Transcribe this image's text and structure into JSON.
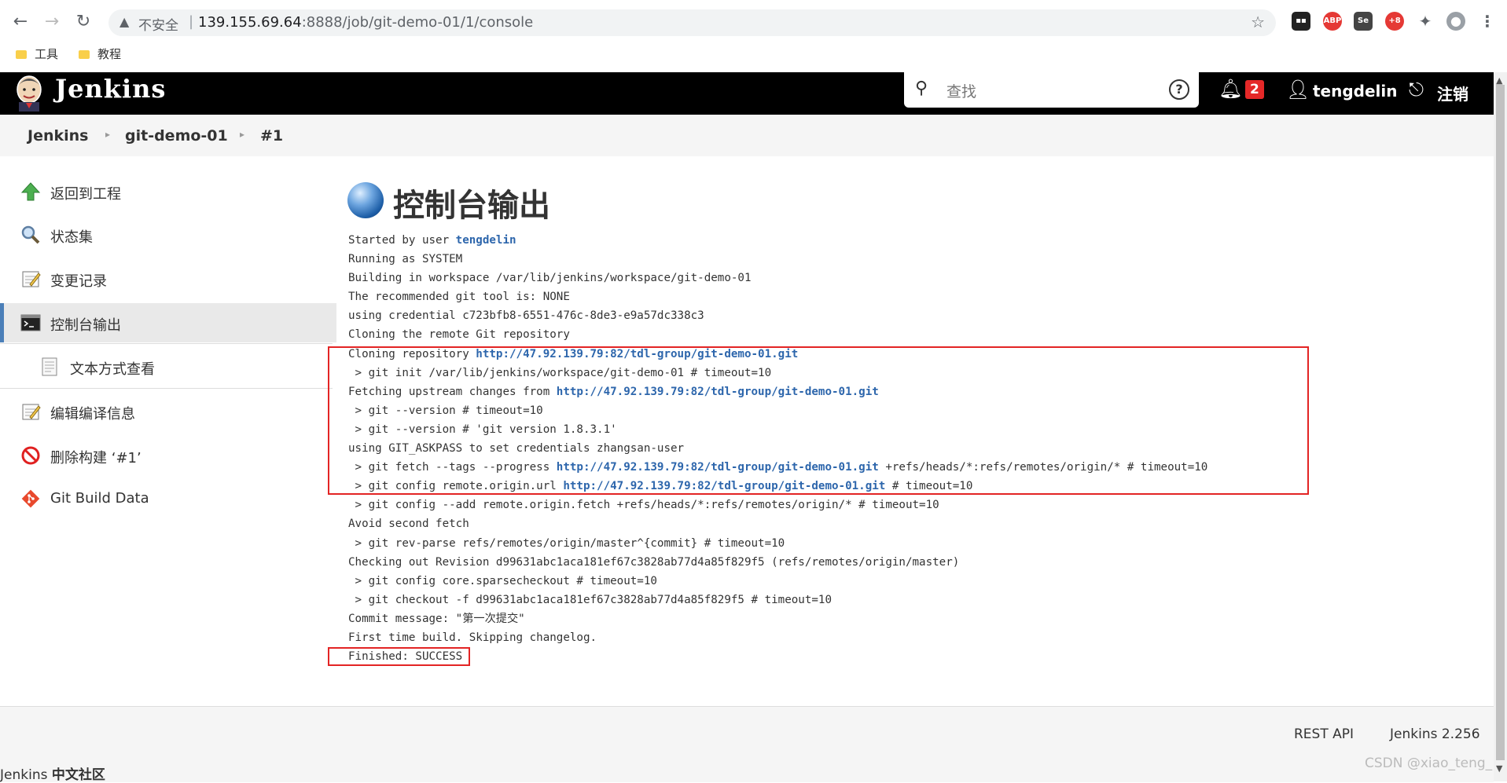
{
  "browser": {
    "insecure_label": "不安全",
    "url_host": "139.155.69.64",
    "url_path": ":8888/job/git-demo-01/1/console",
    "bookmarks": [
      "工具",
      "教程"
    ]
  },
  "header": {
    "title": "Jenkins",
    "search_placeholder": "查找",
    "notification_count": "2",
    "username": "tengdelin",
    "logout": "注销"
  },
  "breadcrumb": [
    "Jenkins",
    "git-demo-01",
    "#1"
  ],
  "sidebar": {
    "items": [
      {
        "label": "返回到工程",
        "icon": "up-arrow-icon"
      },
      {
        "label": "状态集",
        "icon": "magnifier-icon"
      },
      {
        "label": "变更记录",
        "icon": "notepad-icon"
      },
      {
        "label": "控制台输出",
        "icon": "terminal-icon"
      },
      {
        "label": "文本方式查看",
        "icon": "document-icon"
      },
      {
        "label": "编辑编译信息",
        "icon": "notepad-edit-icon"
      },
      {
        "label": "删除构建 ‘#1’",
        "icon": "no-entry-icon"
      },
      {
        "label": "Git Build Data",
        "icon": "git-icon"
      }
    ]
  },
  "main": {
    "title": "控制台输出",
    "console": [
      {
        "t": "Started by user ",
        "link": "tengdelin",
        "r": ""
      },
      {
        "t": "Running as SYSTEM"
      },
      {
        "t": "Building in workspace /var/lib/jenkins/workspace/git-demo-01"
      },
      {
        "t": "The recommended git tool is: NONE"
      },
      {
        "t": "using credential c723bfb8-6551-476c-8de3-e9a57dc338c3"
      },
      {
        "t": "Cloning the remote Git repository"
      },
      {
        "t": "Cloning repository ",
        "link": "http://47.92.139.79:82/tdl-group/git-demo-01.git",
        "r": ""
      },
      {
        "t": " > git init /var/lib/jenkins/workspace/git-demo-01 # timeout=10"
      },
      {
        "t": "Fetching upstream changes from ",
        "link": "http://47.92.139.79:82/tdl-group/git-demo-01.git",
        "r": ""
      },
      {
        "t": " > git --version # timeout=10"
      },
      {
        "t": " > git --version # 'git version 1.8.3.1'"
      },
      {
        "t": "using GIT_ASKPASS to set credentials zhangsan-user"
      },
      {
        "t": " > git fetch --tags --progress ",
        "link": "http://47.92.139.79:82/tdl-group/git-demo-01.git",
        "r": " +refs/heads/*:refs/remotes/origin/* # timeout=10"
      },
      {
        "t": " > git config remote.origin.url ",
        "link": "http://47.92.139.79:82/tdl-group/git-demo-01.git",
        "r": " # timeout=10"
      },
      {
        "t": " > git config --add remote.origin.fetch +refs/heads/*:refs/remotes/origin/* # timeout=10"
      },
      {
        "t": "Avoid second fetch"
      },
      {
        "t": " > git rev-parse refs/remotes/origin/master^{commit} # timeout=10"
      },
      {
        "t": "Checking out Revision d99631abc1aca181ef67c3828ab77d4a85f829f5 (refs/remotes/origin/master)"
      },
      {
        "t": " > git config core.sparsecheckout # timeout=10"
      },
      {
        "t": " > git checkout -f d99631abc1aca181ef67c3828ab77d4a85f829f5 # timeout=10"
      },
      {
        "t": "Commit message: \"第一次提交\""
      },
      {
        "t": "First time build. Skipping changelog."
      },
      {
        "t": "Finished: SUCCESS"
      }
    ]
  },
  "footer": {
    "rest_api": "REST API",
    "version": "Jenkins 2.256",
    "community_prefix": "Jenkins ",
    "community_bold": "中文社区"
  },
  "watermark": "CSDN @xiao_teng_",
  "colors": {
    "header_bg": "#000000",
    "link": "#2d66ac",
    "highlight": "#e32424",
    "badge": "#e52828"
  }
}
